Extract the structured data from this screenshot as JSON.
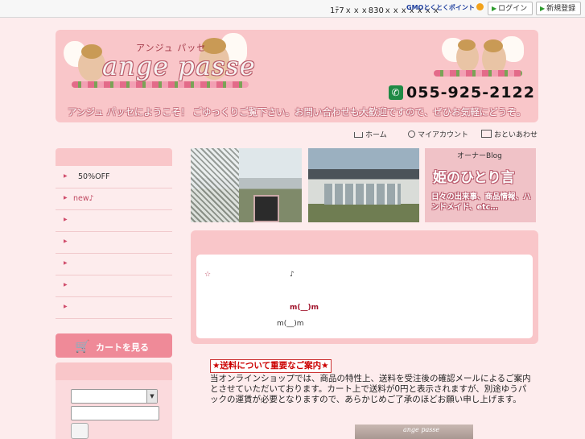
{
  "topbar": {
    "promo_text": "1ﾃ7ｘｘｘ830ｘｘｘｘｘｘｘ",
    "gmo_label": "GMOとくとくポイント",
    "login_label": "ログイン",
    "register_label": "新規登録"
  },
  "header": {
    "kana": "アンジュ パッセ",
    "logo": "ange passe",
    "phone": "055-925-2122",
    "welcome": "アンジュ パッセにようこそ！ ごゆっくりご覧下さい。お問い合わせも大歓迎ですので、ぜひお気軽にどうぞ。"
  },
  "nav": {
    "home": "ホーム",
    "account": "マイアカウント",
    "contact": "おといあわせ"
  },
  "sidebar": {
    "items": [
      {
        "label": "50%OFF"
      },
      {
        "label": "new♪"
      },
      {
        "label": ""
      },
      {
        "label": ""
      },
      {
        "label": ""
      },
      {
        "label": ""
      },
      {
        "label": ""
      }
    ],
    "cart_label": "カートを見る"
  },
  "banners": {
    "owner_blog": "オーナーBlog",
    "blog_title": "姫のひとり言",
    "blog_tagline": "日々の出来事、商品情報、ハンドメイド、etc…"
  },
  "notice": {
    "line1_star": "☆",
    "line1_note": "♪",
    "line2": "m(__)m",
    "line3": "m(__)m"
  },
  "shipping": {
    "title": "★送料について重要なご案内★",
    "body": "当オンラインショップでは、商品の特性上、送料を受注後の確認メールによるご案内とさせていただいております。カート上で送料が0円と表示されますが、別途ゆうパックの運賃が必要となりますので、あらかじめご了承のほどお願い申し上げます。"
  },
  "bottom_image": {
    "label": "ange passe"
  }
}
